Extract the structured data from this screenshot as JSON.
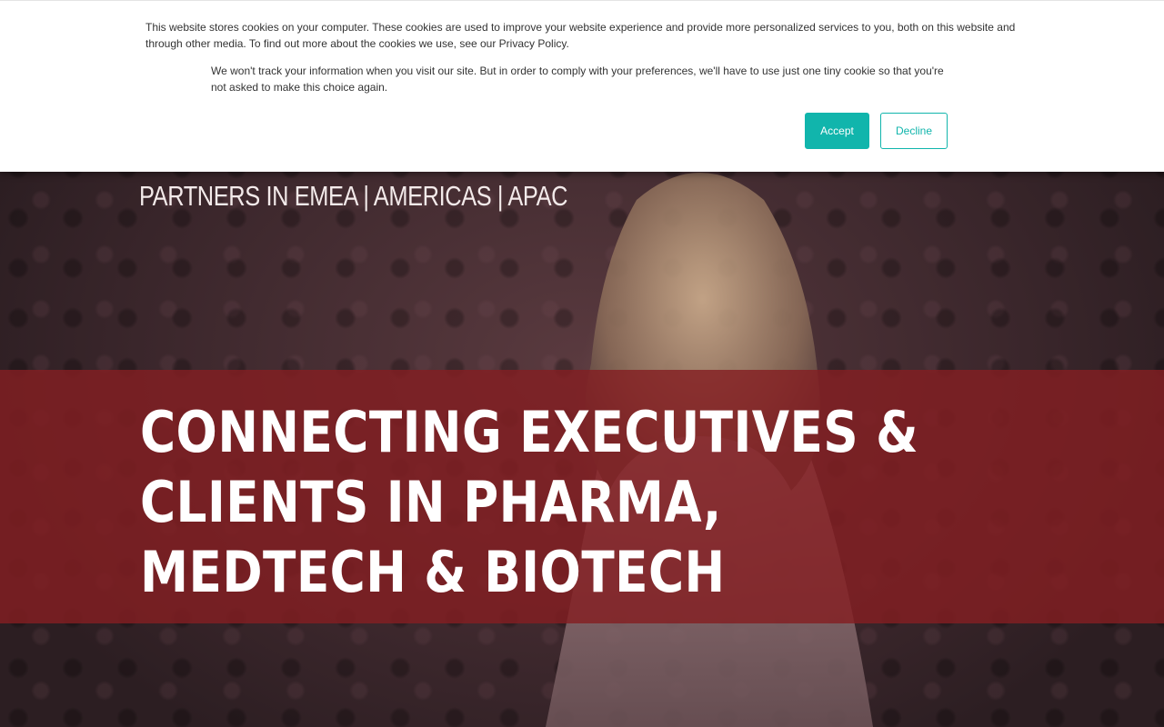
{
  "cookie_banner": {
    "message": "This website stores cookies on your computer. These cookies are used to improve your website experience and provide more personalized services to you, both on this website and through other media. To find out more about the cookies we use, see our Privacy Policy.",
    "opt_out_message": "We won't track your information when you visit our site. But in order to comply with your preferences, we'll have to use just one tiny cookie so that you're not asked to make this choice again.",
    "accept_label": "Accept",
    "decline_label": "Decline",
    "accent_color": "#11b5ac"
  },
  "hero": {
    "tagline": "PARTNERS IN EMEA | AMERICAS | APAC",
    "headline": "CONNECTING EXECUTIVES & CLIENTS IN PHARMA, MEDTECH & BIOTECH",
    "banner_color": "#841e22"
  }
}
